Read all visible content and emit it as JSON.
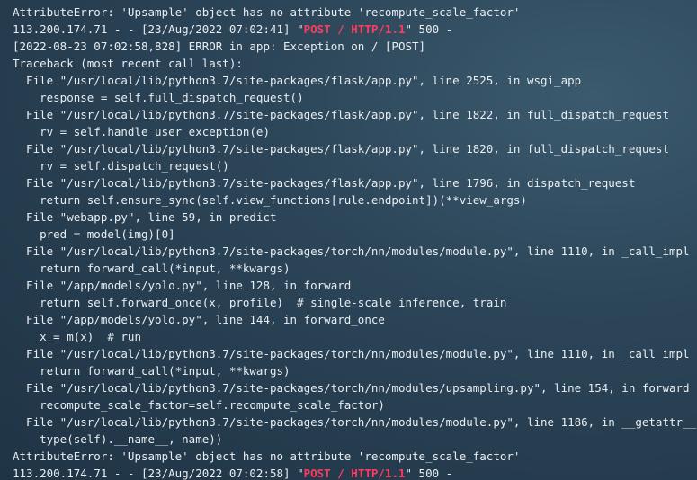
{
  "top_partial": "                                              ",
  "log": {
    "error_1": "AttributeError: 'Upsample' object has no attribute 'recompute_scale_factor'",
    "access_1_prefix": "113.200.174.71 - - [23/Aug/2022 07:02:41] \"",
    "access_1_request": "POST / HTTP/1.1",
    "access_1_suffix": "\" 500 -",
    "error_line": "[2022-08-23 07:02:58,828] ERROR in app: Exception on / [POST]",
    "traceback_header": "Traceback (most recent call last):",
    "frames": [
      "  File \"/usr/local/lib/python3.7/site-packages/flask/app.py\", line 2525, in wsgi_app",
      "    response = self.full_dispatch_request()",
      "  File \"/usr/local/lib/python3.7/site-packages/flask/app.py\", line 1822, in full_dispatch_request",
      "    rv = self.handle_user_exception(e)",
      "  File \"/usr/local/lib/python3.7/site-packages/flask/app.py\", line 1820, in full_dispatch_request",
      "    rv = self.dispatch_request()",
      "  File \"/usr/local/lib/python3.7/site-packages/flask/app.py\", line 1796, in dispatch_request",
      "    return self.ensure_sync(self.view_functions[rule.endpoint])(**view_args)",
      "  File \"webapp.py\", line 59, in predict",
      "    pred = model(img)[0]",
      "  File \"/usr/local/lib/python3.7/site-packages/torch/nn/modules/module.py\", line 1110, in _call_impl",
      "    return forward_call(*input, **kwargs)",
      "  File \"/app/models/yolo.py\", line 128, in forward",
      "    return self.forward_once(x, profile)  # single-scale inference, train",
      "  File \"/app/models/yolo.py\", line 144, in forward_once",
      "    x = m(x)  # run",
      "  File \"/usr/local/lib/python3.7/site-packages/torch/nn/modules/module.py\", line 1110, in _call_impl",
      "    return forward_call(*input, **kwargs)",
      "  File \"/usr/local/lib/python3.7/site-packages/torch/nn/modules/upsampling.py\", line 154, in forward",
      "    recompute_scale_factor=self.recompute_scale_factor)",
      "  File \"/usr/local/lib/python3.7/site-packages/torch/nn/modules/module.py\", line 1186, in __getattr__",
      "    type(self).__name__, name))"
    ],
    "error_2": "AttributeError: 'Upsample' object has no attribute 'recompute_scale_factor'",
    "access_2_prefix": "113.200.174.71 - - [23/Aug/2022 07:02:58] \"",
    "access_2_request": "POST / HTTP/1.1",
    "access_2_suffix": "\" 500 -"
  },
  "colors": {
    "text": "#e8eef2",
    "highlight": "#ff3b5c",
    "background": "#2c4558"
  }
}
